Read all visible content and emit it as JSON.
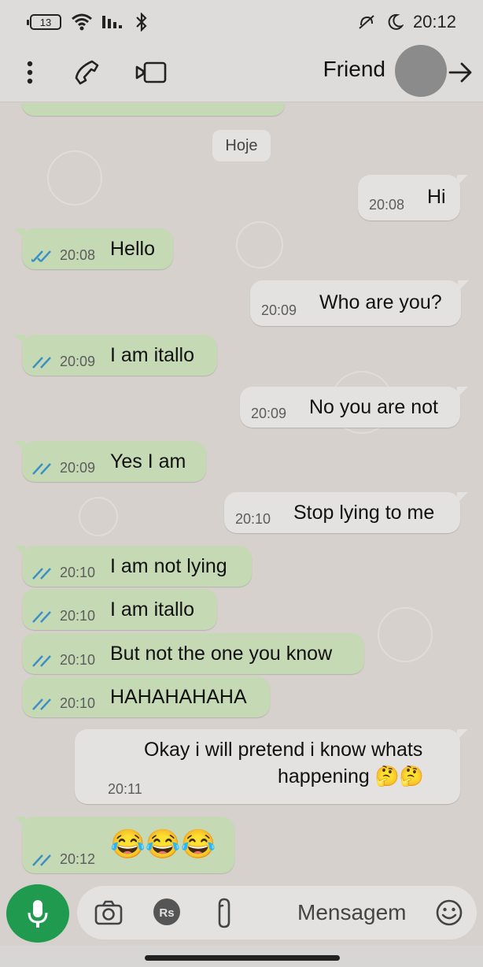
{
  "status_bar": {
    "time": "20:12",
    "battery": "13"
  },
  "header": {
    "contact_name": "Friend",
    "back_icon": "arrow-right-icon",
    "video_icon": "video-call-icon",
    "call_icon": "phone-icon",
    "menu_icon": "more-vertical-icon"
  },
  "chat": {
    "date_chip": "Hoje",
    "messages": [
      {
        "direction": "in",
        "text": "Hi",
        "time": "20:08"
      },
      {
        "direction": "out",
        "text": "Hello",
        "time": "20:08",
        "status": "read"
      },
      {
        "direction": "in",
        "text": "Who are you?",
        "time": "20:09"
      },
      {
        "direction": "out",
        "text": "I am itallo",
        "time": "20:09",
        "status": "read"
      },
      {
        "direction": "in",
        "text": "No you are not",
        "time": "20:09"
      },
      {
        "direction": "out",
        "text": "Yes I am",
        "time": "20:09",
        "status": "read"
      },
      {
        "direction": "in",
        "text": "Stop lying to me",
        "time": "20:10"
      },
      {
        "direction": "out",
        "text": "I am not lying",
        "time": "20:10",
        "status": "read"
      },
      {
        "direction": "out",
        "text": "I am itallo",
        "time": "20:10",
        "status": "read"
      },
      {
        "direction": "out",
        "text": "But not the one you know",
        "time": "20:10",
        "status": "read"
      },
      {
        "direction": "out",
        "text": "HAHAHAHAHA",
        "time": "20:10",
        "status": "read"
      },
      {
        "direction": "in",
        "text_line1": "Okay i will pretend i know whats",
        "text_line2": "happening 🤔🤔",
        "time": "20:11"
      },
      {
        "direction": "out",
        "text": "😂😂😂",
        "time": "20:12",
        "status": "read"
      }
    ]
  },
  "composer": {
    "placeholder": "Mensagem",
    "emoji_icon": "smiley-icon",
    "attach_icon": "paperclip-icon",
    "payment_icon": "rupee-icon",
    "camera_icon": "camera-icon",
    "mic_icon": "microphone-icon"
  },
  "colors": {
    "outgoing_bubble": "#c5d9b5",
    "incoming_bubble": "#e3e2e1",
    "accent_green": "#1f9a4f",
    "read_ticks": "#3a8fc4"
  }
}
